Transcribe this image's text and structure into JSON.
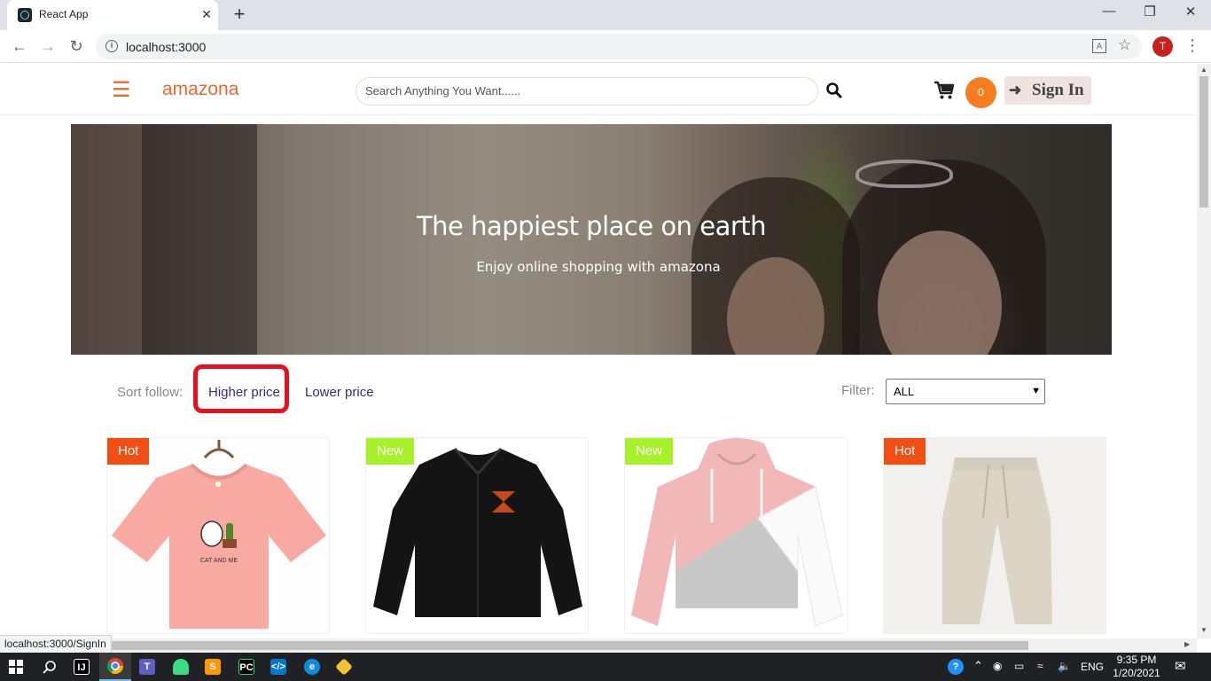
{
  "browser": {
    "tab_title": "React App",
    "tab_close": "✕",
    "new_tab": "+",
    "url": "localhost:3000",
    "status_url": "localhost:3000/SignIn",
    "profile_initial": "T",
    "window_controls": {
      "minimize": "—",
      "restore": "❐",
      "close": "✕"
    }
  },
  "header": {
    "brand": "amazona",
    "menu_icon": "hamburger-icon",
    "search_placeholder": "Search Anything You Want......",
    "cart_count": "0",
    "signin_label": "Sign In",
    "accent_color": "#e9692c"
  },
  "hero": {
    "title": "The happiest place on earth",
    "subtitle": "Enjoy online shopping with amazona"
  },
  "sort": {
    "label": "Sort follow:",
    "options": [
      "Higher price",
      "Lower price"
    ]
  },
  "filter": {
    "label": "Filter:",
    "selected": "ALL"
  },
  "products": [
    {
      "badge": "Hot",
      "badge_color": "#f04e12",
      "image": "pink-cat-tshirt",
      "print": "CAT AND ME"
    },
    {
      "badge": "New",
      "badge_color": "#a6f12a",
      "image": "black-coach-jacket"
    },
    {
      "badge": "New",
      "badge_color": "#a6f12a",
      "image": "pink-grey-white-hoodie"
    },
    {
      "badge": "Hot",
      "badge_color": "#f04e12",
      "image": "beige-linen-pants"
    }
  ],
  "taskbar": {
    "language": "ENG",
    "time": "9:35 PM",
    "date": "1/20/2021"
  }
}
